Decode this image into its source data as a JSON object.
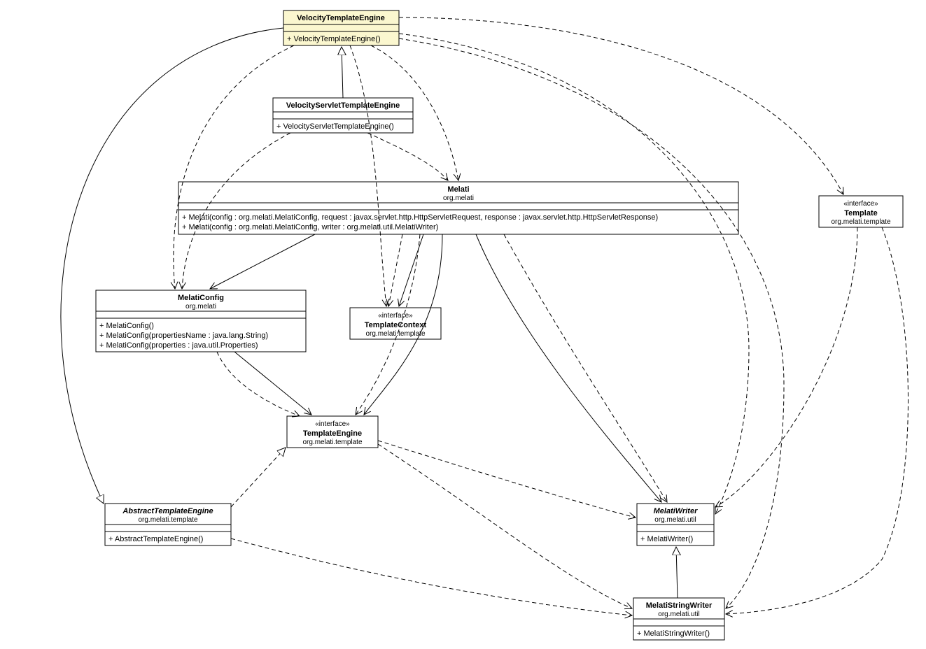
{
  "classes": {
    "vte": {
      "name": "VelocityTemplateEngine",
      "members": [
        "+ VelocityTemplateEngine()"
      ]
    },
    "vste": {
      "name": "VelocityServletTemplateEngine",
      "members": [
        "+ VelocityServletTemplateEngine()"
      ]
    },
    "melati": {
      "name": "Melati",
      "package": "org.melati",
      "members": [
        "+ Melati(config : org.melati.MelatiConfig, request : javax.servlet.http.HttpServletRequest, response : javax.servlet.http.HttpServletResponse)",
        "+ Melati(config : org.melati.MelatiConfig, writer : org.melati.util.MelatiWriter)"
      ]
    },
    "melaticonfig": {
      "name": "MelatiConfig",
      "package": "org.melati",
      "members": [
        "+ MelatiConfig()",
        "+ MelatiConfig(propertiesName : java.lang.String)",
        "+ MelatiConfig(properties : java.util.Properties)"
      ]
    },
    "templatecontext": {
      "stereotype": "«interface»",
      "name": "TemplateContext",
      "package": "org.melati.template"
    },
    "templateengine": {
      "stereotype": "«interface»",
      "name": "TemplateEngine",
      "package": "org.melati.template"
    },
    "ate": {
      "name": "AbstractTemplateEngine",
      "package": "org.melati.template",
      "members": [
        "+ AbstractTemplateEngine()"
      ]
    },
    "melatiwriter": {
      "name": "MelatiWriter",
      "package": "org.melati.util",
      "members": [
        "+ MelatiWriter()"
      ]
    },
    "melatistringwriter": {
      "name": "MelatiStringWriter",
      "package": "org.melati.util",
      "members": [
        "+ MelatiStringWriter()"
      ]
    },
    "template": {
      "stereotype": "«interface»",
      "name": "Template",
      "package": "org.melati.template"
    }
  }
}
